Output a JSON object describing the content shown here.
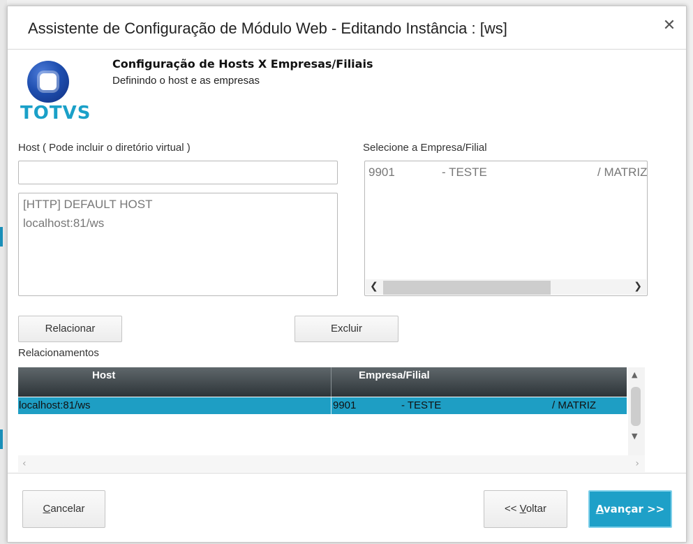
{
  "window": {
    "title": "Assistente de Configuração de Módulo Web - Editando Instância : [ws]",
    "close_glyph": "✕"
  },
  "logo": {
    "text": "TOTVS"
  },
  "step": {
    "title": "Configuração de Hosts X Empresas/Filiais",
    "subtitle": "Definindo o host e as empresas"
  },
  "host": {
    "label": "Host ( Pode incluir o diretório virtual )",
    "value": "",
    "list": [
      "[HTTP] DEFAULT HOST",
      "localhost:81/ws"
    ]
  },
  "empresa": {
    "label": "Selecione a Empresa/Filial",
    "items": [
      {
        "code": "9901",
        "name": "- TESTE",
        "filial": "/ MATRIZ"
      }
    ]
  },
  "buttons": {
    "relacionar": "Relacionar",
    "excluir": "Excluir",
    "cancelar_prefix": "C",
    "cancelar_rest": "ancelar",
    "voltar_prefix": "<< ",
    "voltar_u": "V",
    "voltar_rest": "oltar",
    "avancar_u": "A",
    "avancar_rest": "vançar >>"
  },
  "relacionamentos": {
    "label": "Relacionamentos",
    "columns": [
      "Host",
      "Empresa/Filial"
    ],
    "rows": [
      {
        "host": "localhost:81/ws",
        "code": "9901",
        "name": "- TESTE",
        "filial": "/ MATRIZ"
      }
    ]
  },
  "colors": {
    "accent": "#1ea0c8",
    "header_dark": "#2d3438",
    "logo_blue": "#1aa0c8"
  },
  "icons": {
    "left": "chevron-left-icon",
    "right": "chevron-right-icon",
    "up": "triangle-up-icon",
    "down": "triangle-down-icon"
  }
}
